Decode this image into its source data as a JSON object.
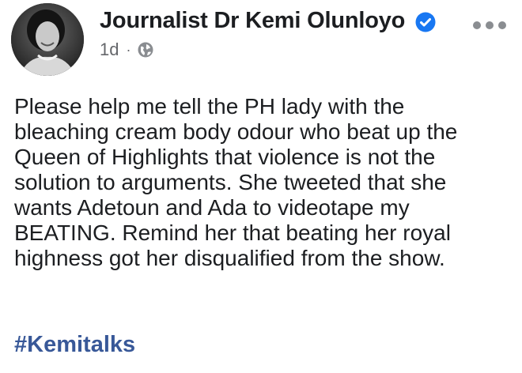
{
  "post": {
    "author": "Journalist Dr Kemi Olunloyo",
    "time": "1d",
    "separator": "·",
    "privacy_icon": "globe-icon",
    "verified_icon": "verified-badge-icon",
    "more_icon": "more-options-icon",
    "body_lines": [
      "Please help me tell the PH lady with the",
      "bleaching cream body odour who beat up the",
      "Queen of Highlights that violence is not the",
      "solution to arguments. She tweeted that she",
      "wants Adetoun and Ada to videotape my",
      "BEATING. Remind her that beating her royal",
      "highness got her disqualified from the show."
    ],
    "hashtag": "#Kemitalks"
  },
  "colors": {
    "name": "#1c1e21",
    "meta": "#65676b",
    "verified": "#1877f2",
    "hashtag": "#385898"
  }
}
